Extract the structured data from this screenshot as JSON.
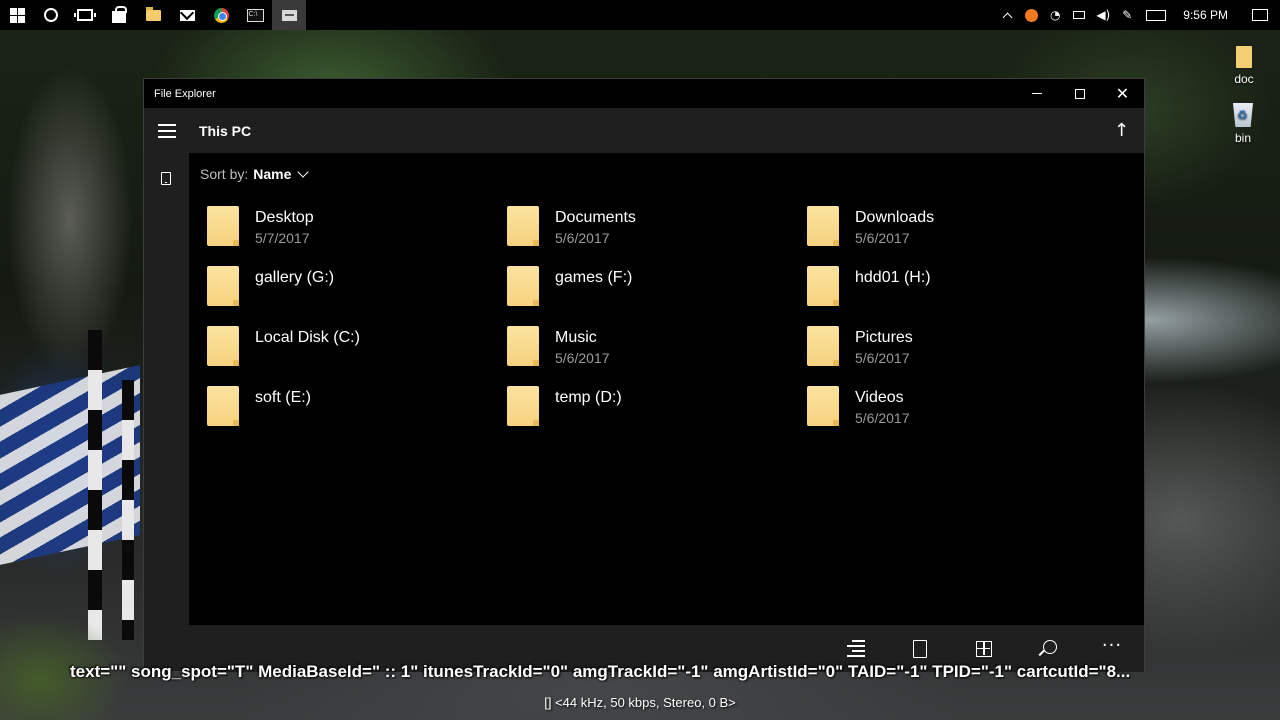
{
  "taskbar": {
    "icons": [
      "windows-logo",
      "cortana-circle",
      "task-view",
      "store-bag",
      "file-explorer-folder",
      "mail-envelope",
      "chrome",
      "command-prompt",
      "file-explorer-app"
    ],
    "tray_icons": [
      "chevron-up",
      "avast",
      "wifi",
      "battery",
      "volume",
      "pen",
      "keyboard"
    ],
    "clock": "9:56 PM"
  },
  "desktop_icons": [
    {
      "label": "doc"
    },
    {
      "label": "bin"
    }
  ],
  "window": {
    "title": "File Explorer",
    "location": "This PC",
    "sort_label": "Sort by:",
    "sort_value": "Name",
    "items": [
      {
        "name": "Desktop",
        "date": "5/7/2017"
      },
      {
        "name": "Documents",
        "date": "5/6/2017"
      },
      {
        "name": "Downloads",
        "date": "5/6/2017"
      },
      {
        "name": "gallery (G:)",
        "date": ""
      },
      {
        "name": "games (F:)",
        "date": ""
      },
      {
        "name": "hdd01 (H:)",
        "date": ""
      },
      {
        "name": "Local Disk (C:)",
        "date": ""
      },
      {
        "name": "Music",
        "date": "5/6/2017"
      },
      {
        "name": "Pictures",
        "date": "5/6/2017"
      },
      {
        "name": "soft (E:)",
        "date": ""
      },
      {
        "name": "temp (D:)",
        "date": ""
      },
      {
        "name": "Videos",
        "date": "5/6/2017"
      }
    ],
    "more_glyph": "···"
  },
  "overlay": {
    "main": "text=\"\" song_spot=\"T\" MediaBaseId=\" :: 1\" itunesTrackId=\"0\" amgTrackId=\"-1\" amgArtistId=\"0\" TAID=\"-1\" TPID=\"-1\" cartcutId=\"8...",
    "sub": "[] <44 kHz, 50 kbps, Stereo, 0 B>"
  },
  "colors": {
    "folder": "#f6d27f",
    "chrome_bg": "#1f1f1f",
    "window_bg": "#000000",
    "date_text": "#9a9a9a"
  }
}
